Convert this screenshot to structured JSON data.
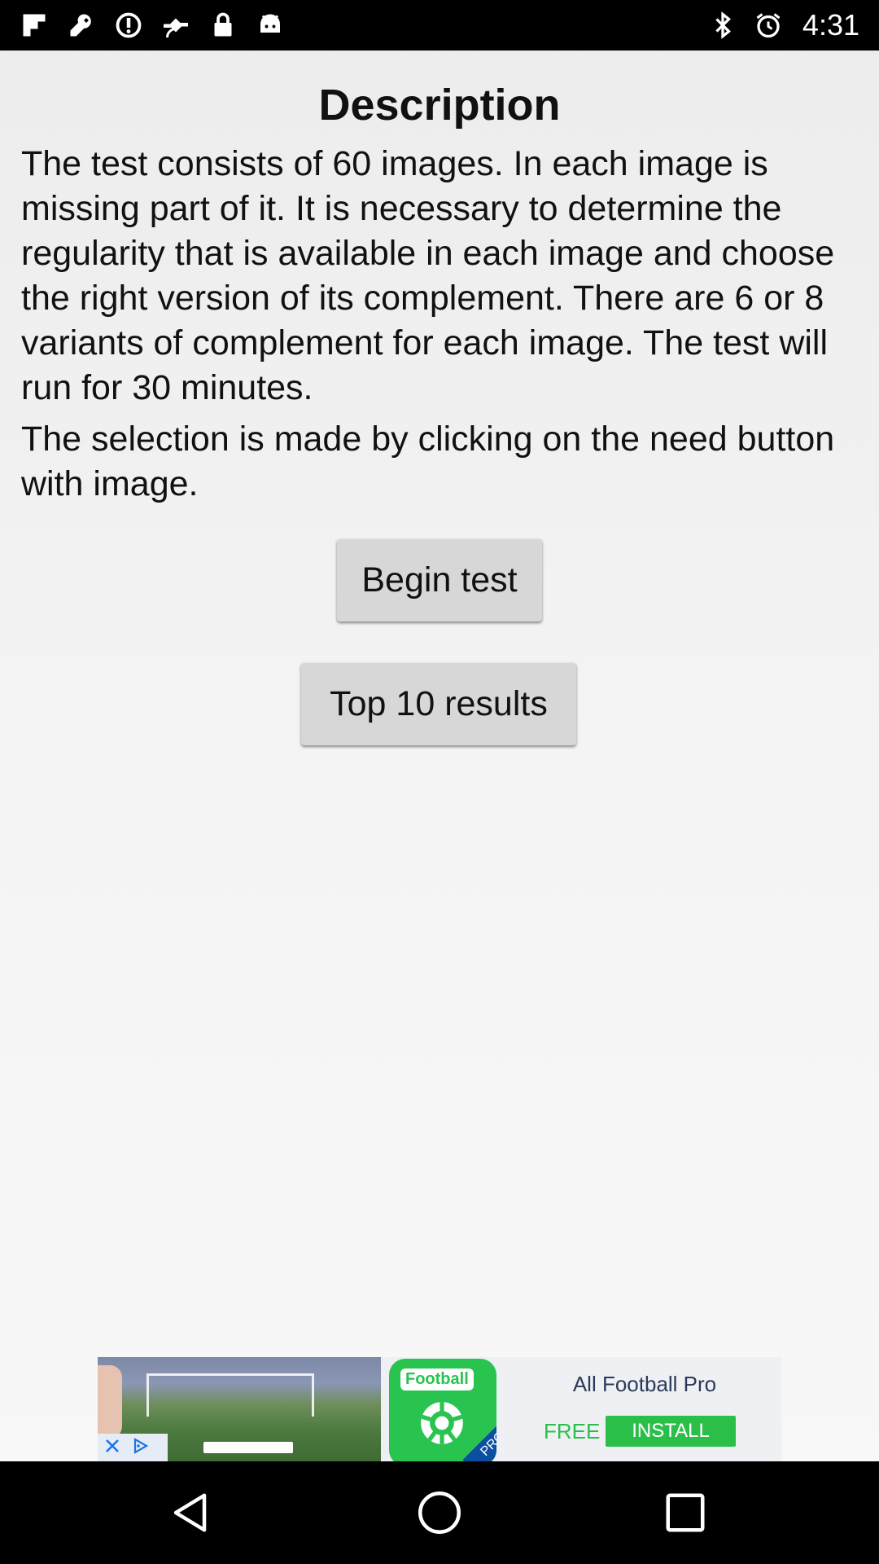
{
  "status_bar": {
    "left_icons": [
      "flipboard-icon",
      "wrench-icon",
      "sync-icon",
      "fake-gps-icon",
      "lock-icon",
      "android-icon"
    ],
    "right_icons": [
      "bluetooth-icon",
      "alarm-icon"
    ],
    "time": "4:31"
  },
  "main": {
    "title": "Description",
    "paragraph1": "The test consists of 60 images. In each image is missing part of it. It is necessary to determine the regularity that is available in each image and choose the right version of its complement. There are 6 or 8 variants of complement for each image. The test will run for 30 minutes.",
    "paragraph2": "The selection is made by clicking on the need button with image.",
    "begin_button": "Begin test",
    "top_button": "Top 10 results"
  },
  "ad": {
    "logo_tag": "Football",
    "logo_badge": "PRO",
    "title": "All Football Pro",
    "free_label": "FREE",
    "install_label": "INSTALL"
  },
  "nav_bar": {
    "icons": [
      "back-icon",
      "home-icon",
      "recents-icon"
    ]
  }
}
